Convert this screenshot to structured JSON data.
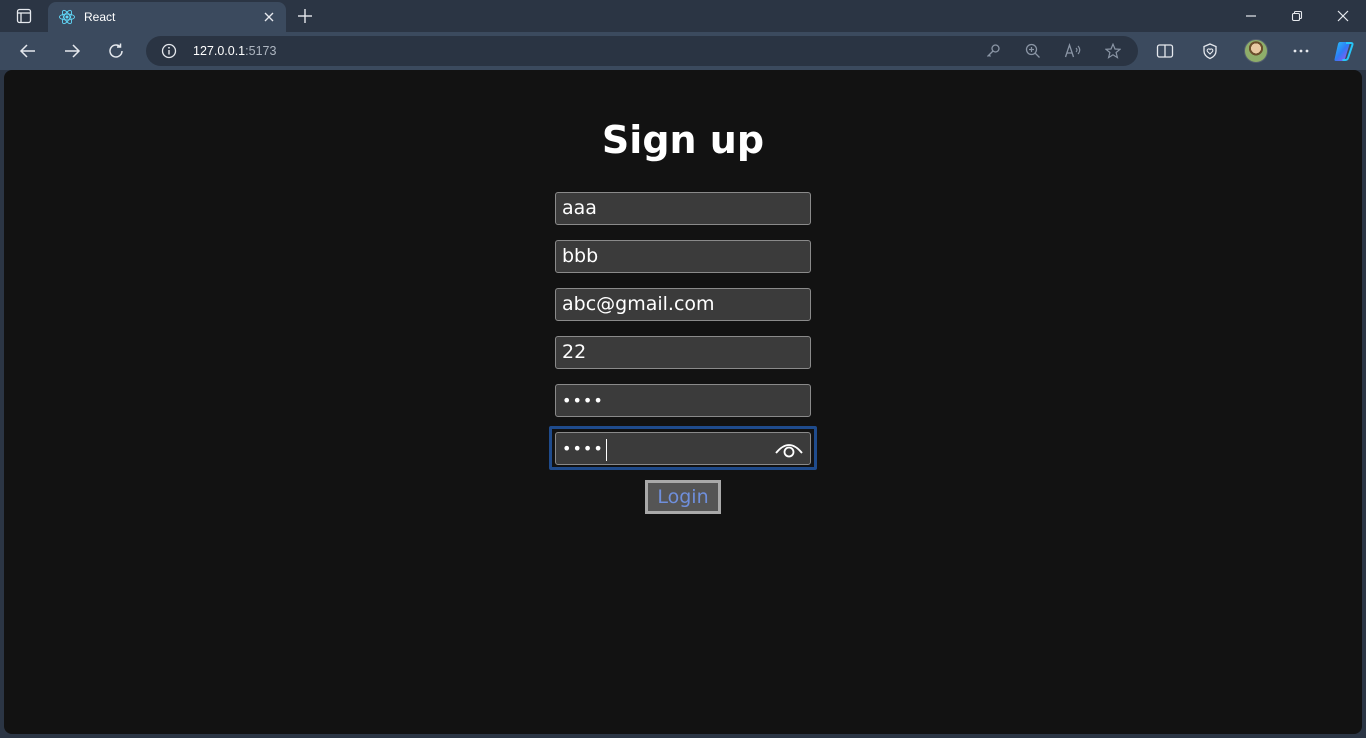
{
  "browser": {
    "tab": {
      "title": "React"
    },
    "address": {
      "host": "127.0.0.1",
      "port": ":5173"
    }
  },
  "page": {
    "title": "Sign up",
    "fields": [
      {
        "value": "aaa"
      },
      {
        "value": "bbb"
      },
      {
        "value": "abc@gmail.com"
      },
      {
        "value": "22"
      },
      {
        "value": "••••"
      },
      {
        "value": "••••"
      }
    ],
    "login_label": "Login"
  },
  "colors": {
    "page_bg": "#121212",
    "input_bg": "#3b3b3b",
    "focus_ring": "#1f4b8c",
    "button_text": "#6f8fdc"
  }
}
